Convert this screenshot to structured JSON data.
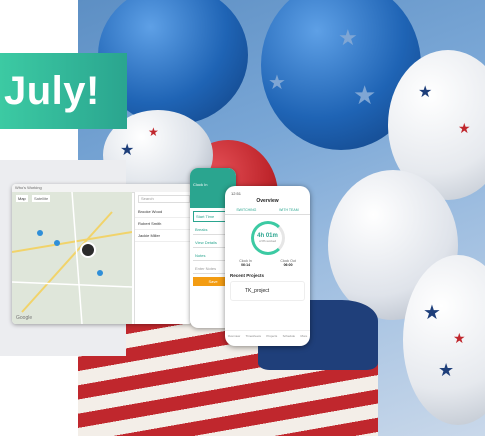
{
  "banner": {
    "text": "July!"
  },
  "tablet": {
    "title": "Who's Working",
    "tabs": [
      "Map",
      "Satellite"
    ],
    "search_placeholder": "Search",
    "people": [
      "Brooke Wood",
      "Robert Smith",
      "Jackie Miller"
    ],
    "map_label": "Google"
  },
  "phone1": {
    "header": "Clock In",
    "buttons": [
      "Start Time",
      "Breaks",
      "View Details",
      "Notes",
      "Enter Notes"
    ],
    "save_label": "Save"
  },
  "phone2": {
    "time": "12:51",
    "title": "Overview",
    "tabs": [
      "SWITCHING",
      "WITH TEAM"
    ],
    "hours": "4h 01m",
    "hours_caption": "of 8h worked",
    "stats": [
      {
        "label": "Clock In",
        "value": "06:14"
      },
      {
        "label": "Clock Out",
        "value": "06:00"
      }
    ],
    "recent_title": "Recent Projects",
    "project_name": "TK_project",
    "nav": [
      "Overview",
      "Timesheets",
      "Projects",
      "Schedule",
      "More"
    ]
  },
  "colors": {
    "accent": "#2aa58f",
    "sky": "#7aa7d6",
    "balloon_blue": "#1f64b5",
    "balloon_red": "#c0272d"
  }
}
